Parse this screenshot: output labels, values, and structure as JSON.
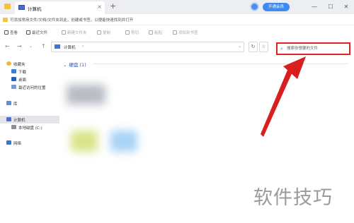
{
  "titlebar": {
    "tab_title": "计算机",
    "tab_close": "×",
    "new_tab": "+",
    "vip_button": "开通会员",
    "minimize": "—",
    "maximize": "☐",
    "close": "✕"
  },
  "notice": {
    "text": "可添加常用文件/文档/文件夹到此，创建或书签，以便能快速找到并打开"
  },
  "toolbar": {
    "items": [
      {
        "label": "查看"
      },
      {
        "label": "最近文件"
      },
      {
        "label": "新建文件夹"
      },
      {
        "label": "复制"
      },
      {
        "label": "剪切"
      },
      {
        "label": "粘贴"
      },
      {
        "label": "添加到书签"
      }
    ]
  },
  "address": {
    "back": "←",
    "forward": "→",
    "dropdown": "⌄",
    "up": "↑",
    "crumb": "计算机",
    "crumb_sep": "›",
    "addr_dropdown": "⌄",
    "refresh": "↻",
    "bookmark": "☆",
    "search_placeholder": "搜索你想要的文件"
  },
  "sidebar": {
    "favorites": "收藏夹",
    "downloads": "下载",
    "desktop": "桌面",
    "recent": "最近访问的位置",
    "library": "库",
    "computer": "计算机",
    "local_disk": "本地磁盘 (C:)",
    "network": "网络"
  },
  "content": {
    "section_title": "硬盘 (1)",
    "section_caret": "⌄"
  },
  "watermark": "软件技巧",
  "colors": {
    "accent": "#3d8bf0",
    "highlight_red": "#e42020",
    "folder_yellow": "#f5c342"
  }
}
